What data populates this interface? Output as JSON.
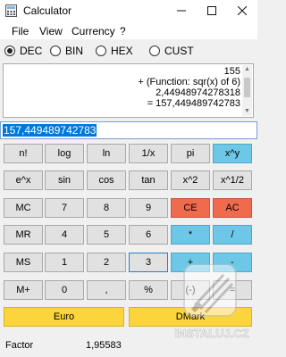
{
  "window": {
    "title": "Calculator",
    "minimize_icon": "minimize-icon",
    "maximize_icon": "maximize-icon",
    "close_icon": "close-icon"
  },
  "menu": [
    "File",
    "View",
    "Currency",
    "?"
  ],
  "modes": [
    {
      "label": "DEC",
      "selected": true
    },
    {
      "label": "BIN",
      "selected": false
    },
    {
      "label": "HEX",
      "selected": false
    },
    {
      "label": "CUST",
      "selected": false
    }
  ],
  "tape": [
    "155",
    "+ (Function: sqr(x) of 6)",
    "2,44948974278318",
    "= 157,449489742783"
  ],
  "display": {
    "value": "157,449489742783"
  },
  "keys": [
    [
      "n!",
      "log",
      "ln",
      "1/x",
      "pi",
      "x^y"
    ],
    [
      "e^x",
      "sin",
      "cos",
      "tan",
      "x^2",
      "x^1/2"
    ],
    [
      "MC",
      "7",
      "8",
      "9",
      "CE",
      "AC"
    ],
    [
      "MR",
      "4",
      "5",
      "6",
      "*",
      "/"
    ],
    [
      "MS",
      "1",
      "2",
      "3",
      "+",
      "-"
    ],
    [
      "M+",
      "0",
      ",",
      "%",
      "(-)",
      "="
    ]
  ],
  "currency_keys": [
    "Euro",
    "DMark"
  ],
  "status": {
    "label": "Factor",
    "value": "1,95583"
  },
  "watermark": {
    "text": "INSTALUJ.CZ"
  },
  "colors": {
    "blue": "#6dc8e8",
    "red": "#f06a4e",
    "gold": "#fcd53c",
    "selection": "#0078d7"
  }
}
